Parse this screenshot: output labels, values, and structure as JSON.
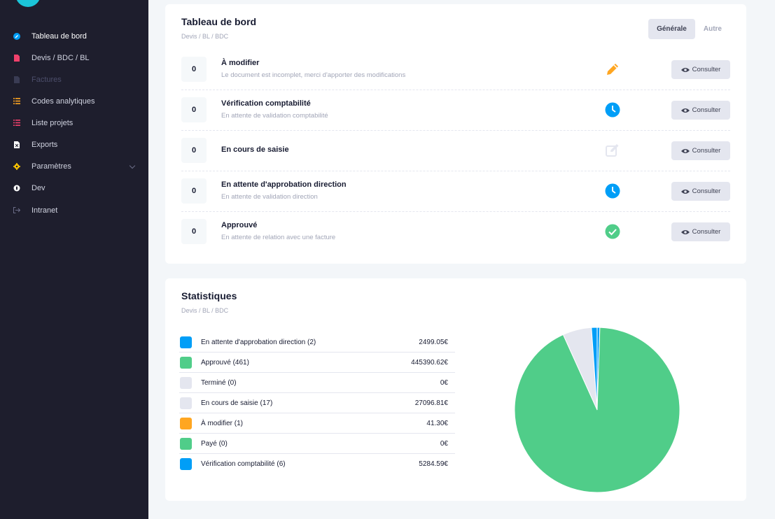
{
  "colors": {
    "sidebar_bg": "#1e1e2d",
    "accent": "#1bc5d8",
    "blue": "#009ef7",
    "green": "#50cd89",
    "orange": "#ffa621",
    "gray": "#e4e6ef"
  },
  "sidebar": {
    "items": [
      {
        "label": "Tableau de bord",
        "icon": "dashboard-icon",
        "state": "active"
      },
      {
        "label": "Devis / BDC / BL",
        "icon": "document-icon",
        "state": "normal"
      },
      {
        "label": "Factures",
        "icon": "invoice-icon",
        "state": "disabled"
      },
      {
        "label": "Codes analytiques",
        "icon": "list-icon",
        "state": "normal"
      },
      {
        "label": "Liste projets",
        "icon": "list-icon",
        "state": "normal"
      },
      {
        "label": "Exports",
        "icon": "excel-icon",
        "state": "normal"
      },
      {
        "label": "Paramètres",
        "icon": "gear-icon",
        "state": "normal"
      },
      {
        "label": "Dev",
        "icon": "bug-icon",
        "state": "normal"
      },
      {
        "label": "Intranet",
        "icon": "sign-out-icon",
        "state": "normal"
      }
    ]
  },
  "dashboard": {
    "title": "Tableau de bord",
    "subtitle": "Devis / BL / BDC",
    "tabs": [
      {
        "label": "Générale",
        "active": true
      },
      {
        "label": "Autre",
        "active": false
      }
    ],
    "button_label": "Consulter",
    "rows": [
      {
        "count": "0",
        "title": "À modifier",
        "desc": "Le document est incomplet, merci d'apporter des modifications",
        "icon": "pencil-icon"
      },
      {
        "count": "0",
        "title": "Vérification comptabilité",
        "desc": "En attente de validation comptabilité",
        "icon": "clock-icon"
      },
      {
        "count": "0",
        "title": "En cours de saisie",
        "desc": "",
        "icon": "edit-icon"
      },
      {
        "count": "0",
        "title": "En attente d'approbation direction",
        "desc": "En attente de validation direction",
        "icon": "clock-icon"
      },
      {
        "count": "0",
        "title": "Approuvé",
        "desc": "En attente de relation avec une facture",
        "icon": "check-circle-icon"
      }
    ]
  },
  "statistics": {
    "title": "Statistiques",
    "subtitle": "Devis / BL / BDC",
    "rows": [
      {
        "label": "En attente d'approbation direction (2)",
        "value": "2499.05€",
        "color": "#009ef7"
      },
      {
        "label": "Approuvé (461)",
        "value": "445390.62€",
        "color": "#50cd89"
      },
      {
        "label": "Terminé (0)",
        "value": "0€",
        "color": "#e4e6ef"
      },
      {
        "label": "En cours de saisie (17)",
        "value": "27096.81€",
        "color": "#e4e6ef"
      },
      {
        "label": "À modifier (1)",
        "value": "41.30€",
        "color": "#ffa621"
      },
      {
        "label": "Payé (0)",
        "value": "0€",
        "color": "#50cd89"
      },
      {
        "label": "Vérification comptabilité (6)",
        "value": "5284.59€",
        "color": "#009ef7"
      }
    ]
  },
  "chart_data": {
    "type": "pie",
    "categories": [
      "En attente d'approbation direction",
      "Approuvé",
      "Terminé",
      "En cours de saisie",
      "À modifier",
      "Payé",
      "Vérification comptabilité"
    ],
    "values": [
      2499.05,
      445390.62,
      0,
      27096.81,
      41.3,
      0,
      5284.59
    ],
    "colors": [
      "#009ef7",
      "#50cd89",
      "#e4e6ef",
      "#e4e6ef",
      "#ffa621",
      "#50cd89",
      "#009ef7"
    ],
    "slice_order_clockwise_from_top": [
      0,
      1,
      3,
      6
    ]
  }
}
